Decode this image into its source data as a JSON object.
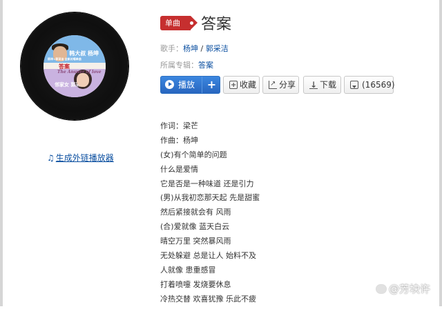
{
  "song": {
    "type_badge": "单曲",
    "title": "答案",
    "artist_label": "歌手：",
    "artists": [
      "杨坤",
      "郭采洁"
    ],
    "artist_separator": " / ",
    "album_label": "所属专辑：",
    "album": "答案"
  },
  "cover": {
    "text_top": "韩大叔 杨坤",
    "text_title": "答案",
    "text_english": "The Answer of love",
    "text_bottom": "邻家女 郭采洁",
    "text_small": "杨坤×郭采洁 全新对唱单曲"
  },
  "actions": {
    "play_label": "播放",
    "add_label": "+",
    "favorite_label": "收藏",
    "share_label": "分享",
    "download_label": "下载",
    "comment_count": "(16569)"
  },
  "player_link": {
    "icon": "♫",
    "label": "生成外链播放器"
  },
  "lyrics": [
    "作词：梁芒",
    "作曲：杨坤",
    "(女)有个简单的问题",
    "什么是爱情",
    "它是否是一种味道 还是引力",
    "(男)从我初恋那天起 先是甜蜜",
    "然后紧接就会有 风雨",
    "(合)爱就像 蓝天白云",
    "晴空万里 突然暴风雨",
    "无处躲避 总是让人 始料不及",
    "人就像 患重感冒",
    "打着喷嚏 发烧要休息",
    "冷热交替 欢喜犹豫 乐此不疲"
  ],
  "watermark": {
    "text": "@芳块许"
  },
  "colors": {
    "badge": "#c62f2f",
    "link": "#0b4fa0",
    "play_button": "#2a6cc4"
  }
}
